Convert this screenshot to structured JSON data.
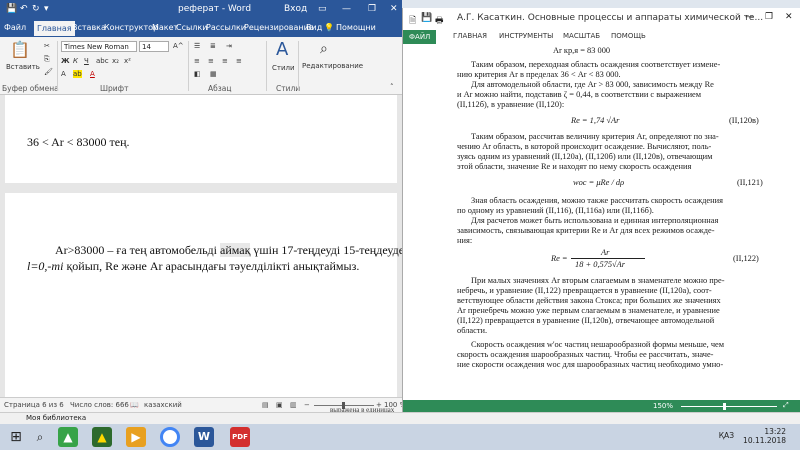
{
  "word": {
    "title": "реферат - Word",
    "signin": "Вход",
    "tabs": [
      "Файл",
      "Главная",
      "Вставка",
      "Конструктор",
      "Макет",
      "Ссылки",
      "Рассылки",
      "Рецензирование",
      "Вид",
      "Помощни"
    ],
    "active_tab": "Главная",
    "ribbon": {
      "paste": "Вставить",
      "font_name": "Times New Roman",
      "font_size": "14",
      "styles": "Стили",
      "editing": "Редактирование",
      "groups": [
        "Буфер обмена",
        "Шрифт",
        "Абзац",
        "Стили"
      ]
    },
    "document": {
      "top_line": "36 < Ar < 83000 тең.",
      "para_line1_plain": "Ar>83000 – ға тең автомобельді ",
      "para_line1_hl": "аймақ",
      "para_line1_rest": " үшін 17-теңдеуді 15-теңдеудегі",
      "para_line2_em": "l=0,-mi",
      "para_line2_rest": " қойып, Re және Ar арасындағы тәуелділікті анықтаймыз."
    },
    "status": {
      "page": "Страница 6 из 6",
      "words": "Число слов: 666",
      "lang": "казахский",
      "zoom": "100 %"
    }
  },
  "reader": {
    "title": "А.Г. Касаткин. Основные процессы и аппараты химической те...",
    "tabs": [
      "ФАЙЛ",
      "ГЛАВНАЯ",
      "ИНСТРУМЕНТЫ",
      "МАСШТАБ",
      "ПОМОЩЬ"
    ],
    "lines": [
      "Ar кр,я = 83 000",
      "Таким образом, переходная область осаждения соответствует измене-",
      "нию критерия Ar в пределах 36 < Ar < 83 000.",
      "Для автомодельной области, где Ar > 83 000, зависимость между Re",
      "и Ar можно найти, подставив ζ = 0,44, в соответствии с выражением",
      "(II,112б), в уравнение (II,120):",
      "Таким образом, рассчитав величину критерия Ar, определяют по зна-",
      "чению Ar область, в которой происходит осаждение. Вычисляют, поль-",
      "зуясь одним из уравнений (II,120а), (II,120б) или (II,120в), отвечающим",
      "этой области, значение Re и находят по нему скорость осаждения",
      "Зная область осаждения, можно также рассчитать скорость осаждения",
      "по одному из уравнений (II,116), (II,116а) или (II,116б).",
      "Для расчетов может быть использована и единная интерполяционная",
      "зависимость, связывающая критерии Re и Ar для всех режимов осажде-",
      "ния:",
      "При малых значениях Ar вторым слагаемым в знаменателе можно пре-",
      "небречь, и уравнение (II,122) превращается в уравнение (II,120а), соот-",
      "ветствующее области действия закона Стокса; при больших же значениях",
      "Ar пренебречь можно уже первым слагаемым в знаменателе, и уравнение",
      "(II,122) превращается в уравнение (II,120в), отвечающее автомодельной",
      "области.",
      "Скорость осаждения w'oc частиц нешарообразной формы меньше, чем",
      "скорость осаждения шарообразных частиц. Чтобы ее рассчитать, значе-",
      "ние скорости осаждения woc для шарообразных частиц необходимо умно-"
    ],
    "eq1": "Re = 1,74 √Ar",
    "eq1_no": "(II,120в)",
    "eq2": "woc = μRe / dρ",
    "eq2_no": "(II,121)",
    "eq3_num": "Ar",
    "eq3_den": "18 + 0,575√Ar",
    "eq3_lhs": "Re =",
    "eq3_no": "(II,122)",
    "zoom": "150%"
  },
  "status_caption": "выражена в единицах",
  "library": "Моя библиотека",
  "clock": {
    "time": "13:22",
    "date": "10.11.2018",
    "lang": "ҚАЗ"
  }
}
